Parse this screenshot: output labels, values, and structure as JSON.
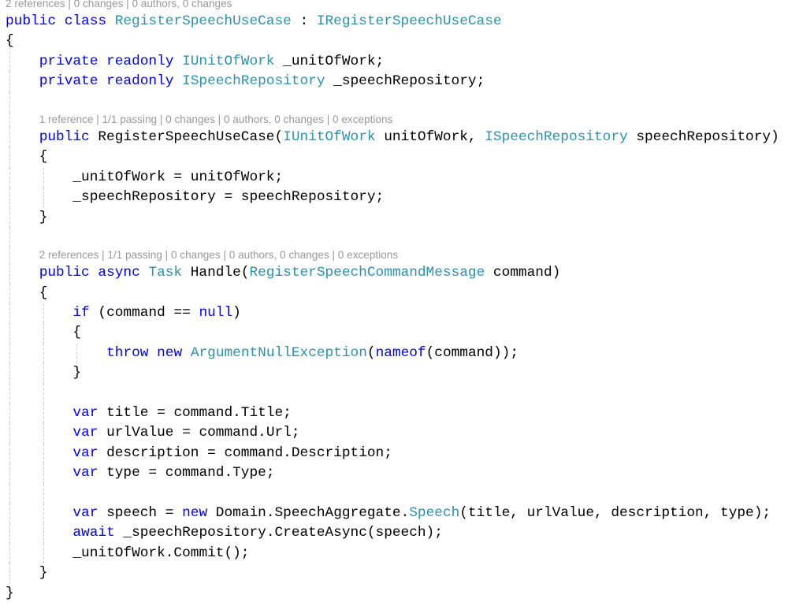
{
  "editor": {
    "colors": {
      "keyword": "#0000ff",
      "type": "#2b91af",
      "plain": "#000000",
      "codelens": "#999999"
    },
    "lines": [
      {
        "kind": "lens",
        "indent": 0,
        "text": "2 references | 0 changes | 0 authors, 0 changes"
      },
      {
        "kind": "code",
        "indent": 0,
        "tokens": [
          {
            "c": "k",
            "t": "public class "
          },
          {
            "c": "t",
            "t": "RegisterSpeechUseCase"
          },
          {
            "c": "p",
            "t": " : "
          },
          {
            "c": "t",
            "t": "IRegisterSpeechUseCase"
          }
        ]
      },
      {
        "kind": "code",
        "indent": 0,
        "tokens": [
          {
            "c": "p",
            "t": "{"
          }
        ]
      },
      {
        "kind": "code",
        "indent": 1,
        "tokens": [
          {
            "c": "k",
            "t": "private readonly "
          },
          {
            "c": "t",
            "t": "IUnitOfWork"
          },
          {
            "c": "p",
            "t": " _unitOfWork;"
          }
        ]
      },
      {
        "kind": "code",
        "indent": 1,
        "tokens": [
          {
            "c": "k",
            "t": "private readonly "
          },
          {
            "c": "t",
            "t": "ISpeechRepository"
          },
          {
            "c": "p",
            "t": " _speechRepository;"
          }
        ]
      },
      {
        "kind": "blank",
        "indent": 1
      },
      {
        "kind": "lens",
        "indent": 1,
        "text": "1 reference | 1/1 passing | 0 changes | 0 authors, 0 changes | 0 exceptions"
      },
      {
        "kind": "code",
        "indent": 1,
        "tokens": [
          {
            "c": "k",
            "t": "public "
          },
          {
            "c": "p",
            "t": "RegisterSpeechUseCase("
          },
          {
            "c": "t",
            "t": "IUnitOfWork"
          },
          {
            "c": "p",
            "t": " unitOfWork, "
          },
          {
            "c": "t",
            "t": "ISpeechRepository"
          },
          {
            "c": "p",
            "t": " speechRepository)"
          }
        ]
      },
      {
        "kind": "code",
        "indent": 1,
        "tokens": [
          {
            "c": "p",
            "t": "{"
          }
        ]
      },
      {
        "kind": "code",
        "indent": 2,
        "tokens": [
          {
            "c": "p",
            "t": "_unitOfWork = unitOfWork;"
          }
        ]
      },
      {
        "kind": "code",
        "indent": 2,
        "tokens": [
          {
            "c": "p",
            "t": "_speechRepository = speechRepository;"
          }
        ]
      },
      {
        "kind": "code",
        "indent": 1,
        "tokens": [
          {
            "c": "p",
            "t": "}"
          }
        ]
      },
      {
        "kind": "blank",
        "indent": 1
      },
      {
        "kind": "lens",
        "indent": 1,
        "text": "2 references | 1/1 passing | 0 changes | 0 authors, 0 changes | 0 exceptions"
      },
      {
        "kind": "code",
        "indent": 1,
        "tokens": [
          {
            "c": "k",
            "t": "public async "
          },
          {
            "c": "t",
            "t": "Task"
          },
          {
            "c": "p",
            "t": " Handle("
          },
          {
            "c": "t",
            "t": "RegisterSpeechCommandMessage"
          },
          {
            "c": "p",
            "t": " command)"
          }
        ]
      },
      {
        "kind": "code",
        "indent": 1,
        "tokens": [
          {
            "c": "p",
            "t": "{"
          }
        ]
      },
      {
        "kind": "code",
        "indent": 2,
        "tokens": [
          {
            "c": "k",
            "t": "if"
          },
          {
            "c": "p",
            "t": " (command == "
          },
          {
            "c": "k",
            "t": "null"
          },
          {
            "c": "p",
            "t": ")"
          }
        ]
      },
      {
        "kind": "code",
        "indent": 2,
        "tokens": [
          {
            "c": "p",
            "t": "{"
          }
        ]
      },
      {
        "kind": "code",
        "indent": 3,
        "tokens": [
          {
            "c": "k",
            "t": "throw new "
          },
          {
            "c": "t",
            "t": "ArgumentNullException"
          },
          {
            "c": "p",
            "t": "("
          },
          {
            "c": "k",
            "t": "nameof"
          },
          {
            "c": "p",
            "t": "(command));"
          }
        ]
      },
      {
        "kind": "code",
        "indent": 2,
        "tokens": [
          {
            "c": "p",
            "t": "}"
          }
        ]
      },
      {
        "kind": "blank",
        "indent": 2
      },
      {
        "kind": "code",
        "indent": 2,
        "tokens": [
          {
            "c": "k",
            "t": "var"
          },
          {
            "c": "p",
            "t": " title = command.Title;"
          }
        ]
      },
      {
        "kind": "code",
        "indent": 2,
        "tokens": [
          {
            "c": "k",
            "t": "var"
          },
          {
            "c": "p",
            "t": " urlValue = command.Url;"
          }
        ]
      },
      {
        "kind": "code",
        "indent": 2,
        "tokens": [
          {
            "c": "k",
            "t": "var"
          },
          {
            "c": "p",
            "t": " description = command.Description;"
          }
        ]
      },
      {
        "kind": "code",
        "indent": 2,
        "tokens": [
          {
            "c": "k",
            "t": "var"
          },
          {
            "c": "p",
            "t": " type = command.Type;"
          }
        ]
      },
      {
        "kind": "blank",
        "indent": 2
      },
      {
        "kind": "code",
        "indent": 2,
        "tokens": [
          {
            "c": "k",
            "t": "var"
          },
          {
            "c": "p",
            "t": " speech = "
          },
          {
            "c": "k",
            "t": "new"
          },
          {
            "c": "p",
            "t": " Domain.SpeechAggregate."
          },
          {
            "c": "t",
            "t": "Speech"
          },
          {
            "c": "p",
            "t": "(title, urlValue, description, type);"
          }
        ]
      },
      {
        "kind": "code",
        "indent": 2,
        "tokens": [
          {
            "c": "k",
            "t": "await"
          },
          {
            "c": "p",
            "t": " _speechRepository.CreateAsync(speech);"
          }
        ]
      },
      {
        "kind": "code",
        "indent": 2,
        "tokens": [
          {
            "c": "p",
            "t": "_unitOfWork.Commit();"
          }
        ]
      },
      {
        "kind": "code",
        "indent": 1,
        "tokens": [
          {
            "c": "p",
            "t": "}"
          }
        ]
      },
      {
        "kind": "code",
        "indent": 0,
        "tokens": [
          {
            "c": "p",
            "t": "}"
          }
        ]
      }
    ]
  }
}
